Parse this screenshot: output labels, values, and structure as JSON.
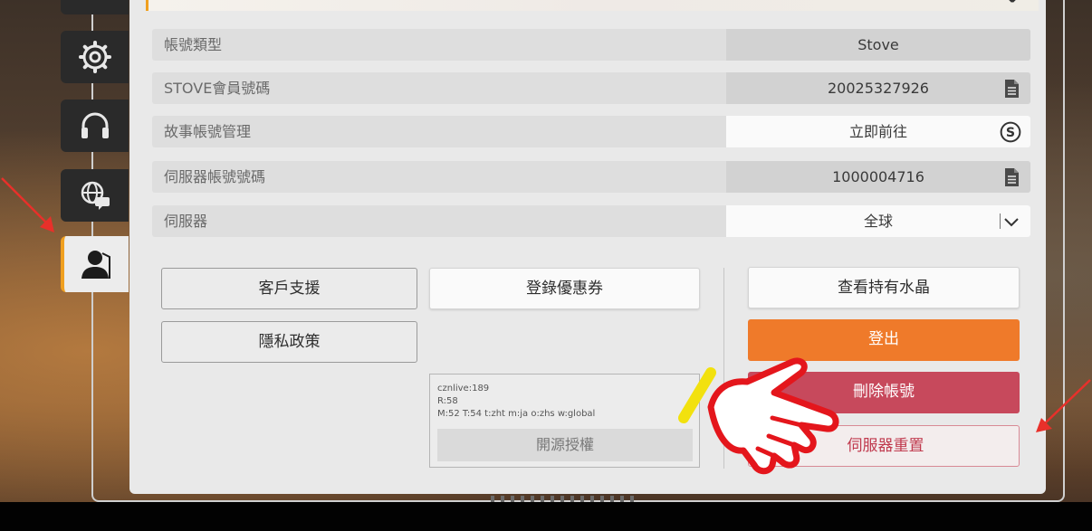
{
  "sidebar": {
    "tabs": [
      {
        "icon": "gear-icon"
      },
      {
        "icon": "headset-icon"
      },
      {
        "icon": "globe-chat-icon"
      },
      {
        "icon": "user-icon",
        "active": true
      }
    ]
  },
  "account": {
    "rows": [
      {
        "label": "帳號類型",
        "value": "Stove"
      },
      {
        "label": "STOVE會員號碼",
        "value": "20025327926",
        "icon": "copy-icon"
      },
      {
        "label": "故事帳號管理",
        "value": "立即前往",
        "icon": "stove-s-icon"
      },
      {
        "label": "伺服器帳號號碼",
        "value": "1000004716",
        "icon": "copy-icon"
      },
      {
        "label": "伺服器",
        "value": "全球",
        "icon": "chevron-down-icon"
      }
    ]
  },
  "buttons": {
    "support": "客戶支援",
    "privacy": "隱私政策",
    "coupon": "登錄優惠券",
    "crystal": "查看持有水晶",
    "logout": "登出",
    "delete": "刪除帳號",
    "server_reset": "伺服器重置"
  },
  "info": {
    "line1": "cznlive:189",
    "line2": "R:58",
    "line3": "M:52 T:54 t:zht m:ja o:zhs w:global",
    "license": "開源授權"
  },
  "colors": {
    "accent": "#f0a020",
    "logout": "#ef7a2a",
    "delete": "#c7495c",
    "annotation_arrow": "#e8302a"
  }
}
